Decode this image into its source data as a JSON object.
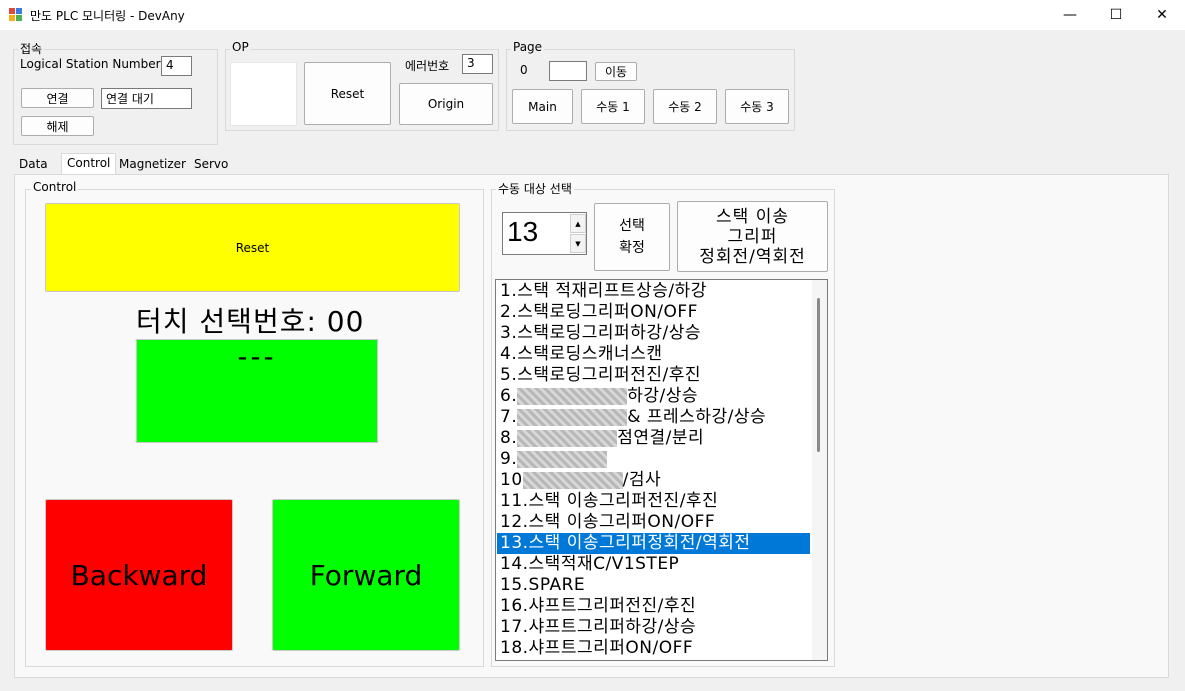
{
  "window": {
    "title": "만도 PLC 모니터링 - DevAny",
    "minimize": "—",
    "maximize": "☐",
    "close": "✕"
  },
  "connection": {
    "group_label": "접속",
    "station_label": "Logical Station Number",
    "station_value": "4",
    "connect_button": "연결",
    "status_value": "연결 대기",
    "disconnect_button": "해제"
  },
  "op": {
    "group_label": "OP",
    "reset_button": "Reset",
    "error_label": "에러번호",
    "error_value": "3",
    "origin_button": "Origin"
  },
  "page": {
    "group_label": "Page",
    "current": "0",
    "input_value": "",
    "move_button": "이동",
    "buttons": [
      "Main",
      "수동 1",
      "수동 2",
      "수동 3"
    ]
  },
  "tabs": [
    "Data",
    "Control",
    "Magnetizer",
    "Servo"
  ],
  "active_tab": "Control",
  "control": {
    "group_label": "Control",
    "reset_button": "Reset",
    "touch_label": "터치 선택번호: 00",
    "green_display": "---",
    "backward_button": "Backward",
    "forward_button": "Forward",
    "colors": {
      "reset": "#ffff00",
      "green": "#00ff00",
      "backward": "#ff0000"
    }
  },
  "manual": {
    "group_label": "수동 대상 선택",
    "spinner_value": "13",
    "confirm_button_line1": "선택",
    "confirm_button_line2": "확정",
    "target_line1": "스택 이송",
    "target_line2": "그리퍼",
    "target_line3": "정회전/역회전",
    "selected_index": 12,
    "selection_color": "#0078d7",
    "items": [
      {
        "prefix": "1.스택 적재리프트상승/하강",
        "blur": 0,
        "suffix": ""
      },
      {
        "prefix": "2.스택로딩그리퍼ON/OFF",
        "blur": 0,
        "suffix": ""
      },
      {
        "prefix": "3.스택로딩그리퍼하강/상승",
        "blur": 0,
        "suffix": ""
      },
      {
        "prefix": "4.스택로딩스캐너스캔",
        "blur": 0,
        "suffix": ""
      },
      {
        "prefix": "5.스택로딩그리퍼전진/후진",
        "blur": 0,
        "suffix": ""
      },
      {
        "prefix": "6.",
        "blur": 110,
        "suffix": "하강/상승"
      },
      {
        "prefix": "7.",
        "blur": 110,
        "suffix": "& 프레스하강/상승"
      },
      {
        "prefix": "8.",
        "blur": 100,
        "suffix": "점연결/분리"
      },
      {
        "prefix": "9.",
        "blur": 90,
        "suffix": ""
      },
      {
        "prefix": "10",
        "blur": 100,
        "suffix": "/검사"
      },
      {
        "prefix": "11.스택 이송그리퍼전진/후진",
        "blur": 0,
        "suffix": ""
      },
      {
        "prefix": "12.스택 이송그리퍼ON/OFF",
        "blur": 0,
        "suffix": ""
      },
      {
        "prefix": "13.스택 이송그리퍼정회전/역회전",
        "blur": 0,
        "suffix": ""
      },
      {
        "prefix": "14.스택적재C/V1STEP",
        "blur": 0,
        "suffix": ""
      },
      {
        "prefix": "15.SPARE",
        "blur": 0,
        "suffix": ""
      },
      {
        "prefix": "16.샤프트그리퍼전진/후진",
        "blur": 0,
        "suffix": ""
      },
      {
        "prefix": "17.샤프트그리퍼하강/상승",
        "blur": 0,
        "suffix": ""
      },
      {
        "prefix": "18.샤프트그리퍼ON/OFF",
        "blur": 0,
        "suffix": ""
      }
    ]
  }
}
